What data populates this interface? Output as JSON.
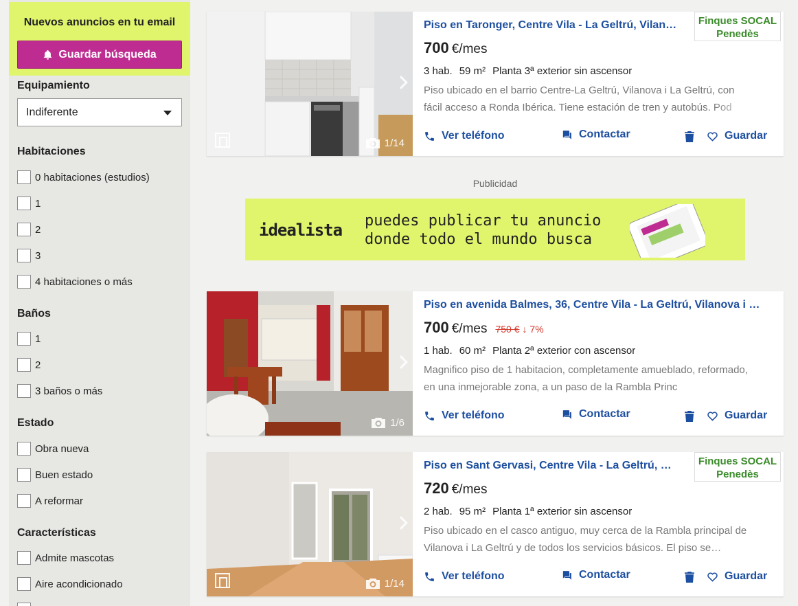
{
  "sidebar": {
    "promo_title": "Nuevos anuncios en tu email",
    "save_search_label": "Guardar búsqueda",
    "equipamiento": {
      "title": "Equipamiento",
      "selected": "Indiferente"
    },
    "habitaciones": {
      "title": "Habitaciones",
      "options": [
        "0 habitaciones (estudios)",
        "1",
        "2",
        "3",
        "4 habitaciones o más"
      ]
    },
    "banos": {
      "title": "Baños",
      "options": [
        "1",
        "2",
        "3 baños o más"
      ]
    },
    "estado": {
      "title": "Estado",
      "options": [
        "Obra nueva",
        "Buen estado",
        "A reformar"
      ]
    },
    "caracteristicas": {
      "title": "Características",
      "options": [
        "Admite mascotas",
        "Aire acondicionado"
      ]
    }
  },
  "listings": [
    {
      "title": "Piso en Taronger, Centre Vila - La Geltrú, Vilan…",
      "price": "700",
      "price_unit": "€/mes",
      "details": [
        "3 hab.",
        "59 m²",
        "Planta 3ª exterior sin ascensor"
      ],
      "description": "Piso ubicado en el barrio Centre-La Geltrú, Vilanova i La Geltrú, con fácil acceso a Ronda Ibérica. Tiene estación de tren y autobús. Pod",
      "photo_count": "1/14",
      "agency": [
        "Finques SOCAL",
        "Penedès"
      ]
    },
    {
      "title": "Piso en avenida Balmes, 36, Centre Vila - La Geltrú, Vilanova i …",
      "price": "700",
      "price_unit": "€/mes",
      "old_price": "750 €",
      "price_drop": "↓ 7%",
      "details": [
        "1 hab.",
        "60 m²",
        "Planta 2ª exterior con ascensor"
      ],
      "description": "Magnifico piso de 1 habitacion, completamente amueblado, reformado, en una inmejorable zona, a un paso de la Rambla Princ",
      "photo_count": "1/6"
    },
    {
      "title": "Piso en Sant Gervasi, Centre Vila - La Geltrú, …",
      "price": "720",
      "price_unit": "€/mes",
      "details": [
        "2 hab.",
        "95 m²",
        "Planta 1ª exterior sin ascensor"
      ],
      "description": "Piso ubicado en el casco antiguo, muy cerca de la Rambla principal de Vilanova i La Geltrú y de todos los servicios básicos. El piso se…",
      "photo_count": "1/14",
      "agency": [
        "Finques SOCAL",
        "Penedès"
      ]
    }
  ],
  "actions": {
    "phone": "Ver teléfono",
    "contact": "Contactar",
    "save": "Guardar"
  },
  "ad": {
    "label": "Publicidad",
    "logo": "idealista",
    "line1": "puedes publicar tu anuncio",
    "line2": "donde todo el mundo busca"
  },
  "colors": {
    "promo_bg": "#e1f56c",
    "save_btn": "#bf2c91",
    "link": "#1d4fa0",
    "price_drop": "#d4382c",
    "agency_text": "#3a8b2a"
  },
  "icons": [
    "bell-icon",
    "caret-down-icon",
    "phone-icon",
    "chat-icon",
    "trash-icon",
    "heart-icon",
    "camera-icon",
    "floorplan-icon",
    "chevron-right-icon"
  ]
}
